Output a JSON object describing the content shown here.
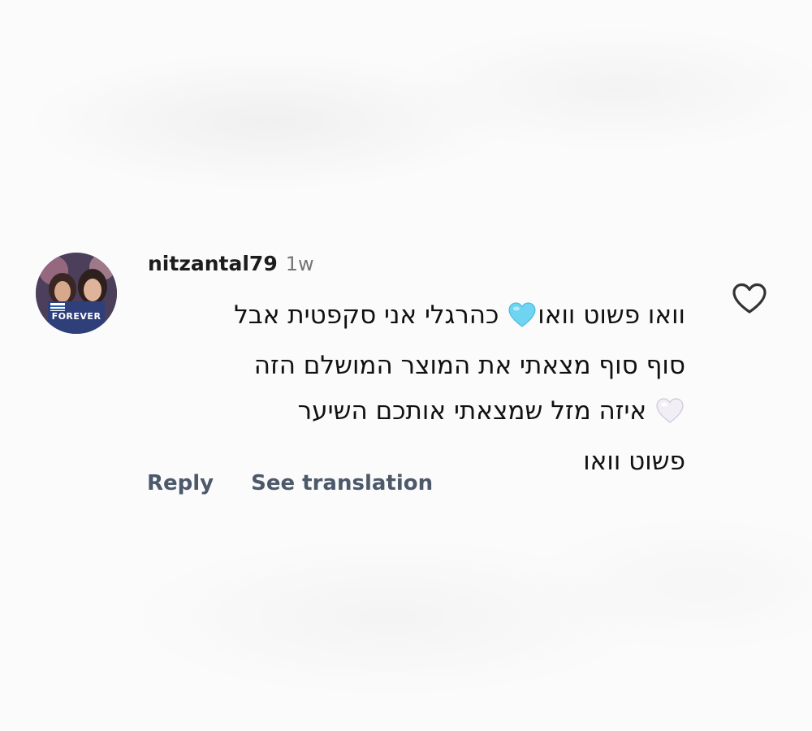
{
  "comment": {
    "username": "nitzantal79",
    "timestamp": "1w",
    "avatar_caption": "FOREVER",
    "text_lines": [
      {
        "before": "וואו פשוט וואו",
        "emoji": "light-blue-heart-icon",
        "after": " כהרגלי אני סקפטית אבל"
      },
      {
        "before": "סוף סוף מצאתי את המוצר המושלם הזה",
        "emoji": null,
        "after": ""
      },
      {
        "before": "",
        "emoji": "white-heart-icon",
        "after": " איזה מזל שמצאתי אותכם השיער"
      },
      {
        "before": "פשוט וואו",
        "emoji": null,
        "after": ""
      }
    ],
    "actions": {
      "reply_label": "Reply",
      "translate_label": "See translation"
    },
    "like_icon": "heart-outline-icon"
  },
  "colors": {
    "username": "#1c1c1c",
    "timestamp": "#747474",
    "text": "#111111",
    "actions": "#4d586a",
    "light_blue_heart": "#6fd3f2",
    "white_heart": "#f1eef6"
  }
}
